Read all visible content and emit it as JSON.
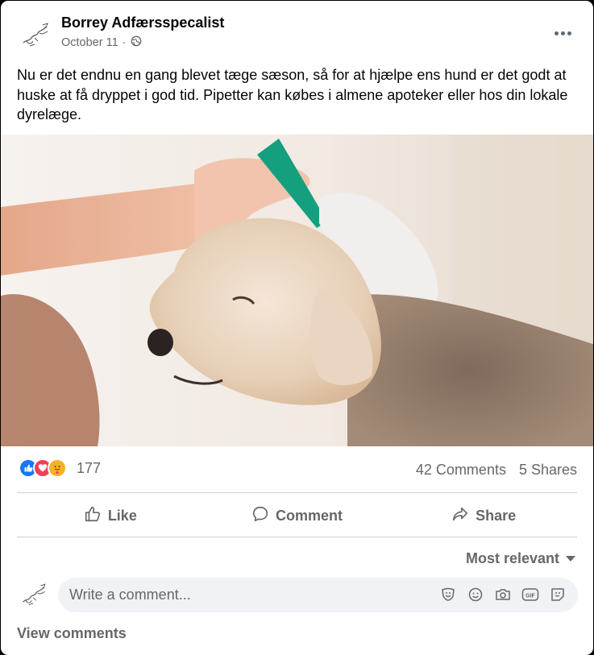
{
  "post": {
    "author": "Borrey Adfærsspecalist",
    "date": "October 11",
    "separator": "·",
    "text": "Nu er det endnu en gang blevet tæge sæson, så for at hjælpe ens hund er det godt at huske at få dryppet i god tid. Pipetter kan købes i almene apoteker eller hos din lokale dyrelæge."
  },
  "reactions": {
    "icons": [
      "like-icon",
      "love-icon",
      "care-icon"
    ],
    "count": "177",
    "comments": "42 Comments",
    "shares": "5 Shares"
  },
  "actions": {
    "like": "Like",
    "comment": "Comment",
    "share": "Share"
  },
  "comments": {
    "sort_label": "Most relevant",
    "placeholder": "Write a comment...",
    "tools": [
      "sticker-icon",
      "emoji-icon",
      "camera-icon",
      "gif-icon",
      "avatar-sticker-icon"
    ],
    "view_label": "View comments"
  },
  "colors": {
    "like": "#1877f2",
    "love": "#f33e58",
    "care": "#f7b125",
    "secondary_text": "#65676b",
    "input_bg": "#f0f2f5"
  }
}
